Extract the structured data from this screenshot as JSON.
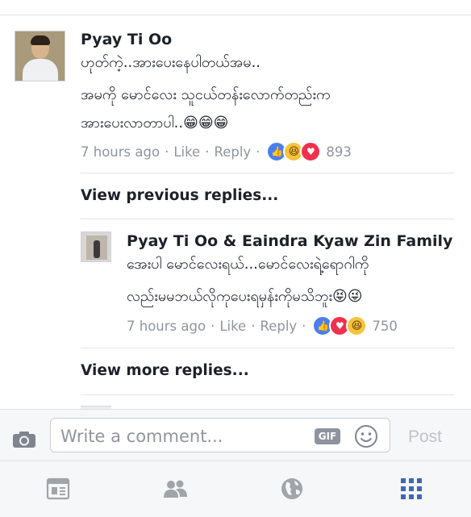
{
  "comment": {
    "author": "Pyay Ti Oo",
    "lines": [
      "ဟုတ်ကဲ့..အားပေးနေပါတယ်အမ..",
      "အမကို မောင်လေး သူငယ်တန်းလောက်တည်းက",
      "အားပေးလာတာပါ.."
    ],
    "emojis": "😁😁😁",
    "time": "7 hours ago",
    "like": "Like",
    "reply": "Reply",
    "reaction_count": "893"
  },
  "view_previous": "View previous replies...",
  "reply": {
    "author": "Pyay Ti Oo & Eaindra Kyaw Zin Family",
    "lines": [
      "အေးပါ မောင်လေးရယ်...မောင်လေးရဲ့ရောဂါကို",
      "လည်းမမဘယ်လိုကုပေးရမှန်းကိုမသိဘူး"
    ],
    "emojis": "😝😜",
    "time": "7 hours ago",
    "like": "Like",
    "reply": "Reply",
    "reaction_count": "750"
  },
  "view_more": "View more replies...",
  "composer": {
    "placeholder": "Write a comment...",
    "gif_label": "GIF",
    "post_label": "Post"
  },
  "colors": {
    "accent": "#4267b2",
    "like": "#4a7ff0",
    "love": "#f0304e",
    "haha": "#f7c33d"
  }
}
